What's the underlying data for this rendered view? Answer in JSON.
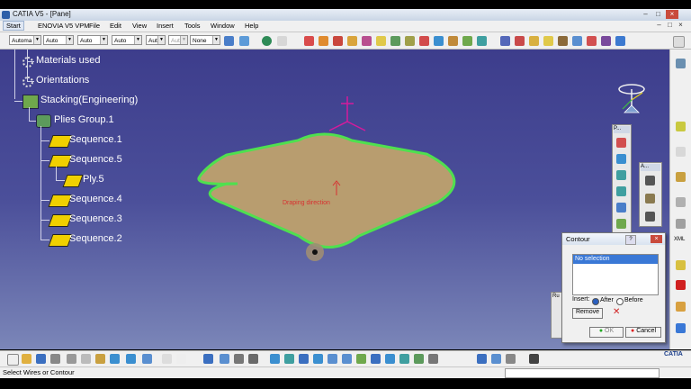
{
  "window": {
    "title": "CATIA V5 - [Pane]",
    "controls": [
      "–",
      "□",
      "×"
    ]
  },
  "menubar": {
    "items": [
      "Start",
      "ENOVIA V5 VPM",
      "File",
      "Edit",
      "View",
      "Insert",
      "Tools",
      "Window",
      "Help"
    ]
  },
  "toolbar_top": {
    "combos": [
      "Automa",
      "Auto",
      "Auto",
      "Auto",
      "Aut",
      "Aut",
      "None"
    ]
  },
  "tree": {
    "nodes": [
      {
        "label": "Materials used"
      },
      {
        "label": "Orientations"
      },
      {
        "label": "Stacking(Engineering)"
      },
      {
        "label": "Plies Group.1"
      },
      {
        "label": "Sequence.1"
      },
      {
        "label": "Sequence.5"
      },
      {
        "label": "Ply.5"
      },
      {
        "label": "Sequence.4"
      },
      {
        "label": "Sequence.3"
      },
      {
        "label": "Sequence.2"
      }
    ]
  },
  "viewport": {
    "annotation": "Draping direction",
    "shape_fill": "#b89d6f",
    "shape_outline": "#4fe04f"
  },
  "panels": {
    "p_toolbar_label": "P...",
    "a_toolbar_label": "A...",
    "behind_label": "Ru"
  },
  "contour_dialog": {
    "title": "Contour",
    "list_selected": "No selection",
    "insert_label": "Insert:",
    "after_label": "After",
    "before_label": "Before",
    "remove_label": "Remove",
    "ok_label": "OK",
    "cancel_label": "Cancel"
  },
  "sidebar": {
    "xml_label": "XML"
  },
  "status": {
    "text": "Select Wires or Contour"
  },
  "branding": {
    "logo_text": "CATIA"
  }
}
